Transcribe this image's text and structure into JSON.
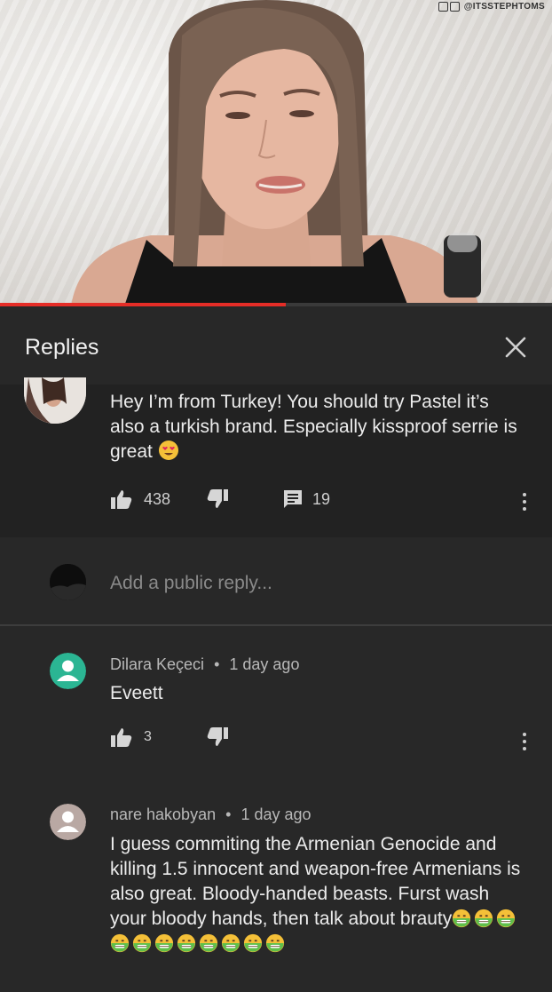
{
  "watermark": "@ITSSTEPHTOMS",
  "panel": {
    "title": "Replies"
  },
  "main_comment": {
    "text": "Hey I’m from Turkey! You should try Pastel it’s also a turkish brand. Especially kissproof serrie is great",
    "likes": "438",
    "replies": "19"
  },
  "reply_input": {
    "placeholder": "Add a public reply..."
  },
  "replies": [
    {
      "author": "Dilara Keçeci",
      "sep": "•",
      "time": "1 day ago",
      "text": "Eveett",
      "likes": "3",
      "avatar_color": "#2bb593"
    },
    {
      "author": "nare hakobyan",
      "sep": "•",
      "time": "1 day ago",
      "text": "I guess commiting the Armenian Genocide and killing 1.5 innocent and weapon-free Armenians is also great. Bloody-handed beasts. Furst wash your bloody hands, then talk about brauty",
      "avatar_color": "#b9a8a3"
    }
  ],
  "colors": {
    "accent": "#e52d27",
    "background": "#222222",
    "panel": "#282828"
  }
}
